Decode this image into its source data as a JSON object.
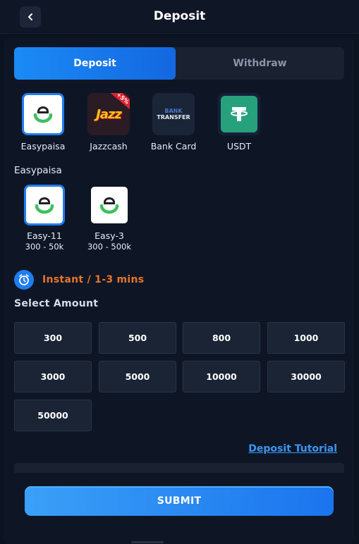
{
  "header": {
    "title": "Deposit"
  },
  "tabs": [
    {
      "label": "Deposit",
      "active": true
    },
    {
      "label": "Withdraw",
      "active": false
    }
  ],
  "methods": [
    {
      "label": "Easypaisa",
      "icon": "easypaisa-logo-icon",
      "selected": true
    },
    {
      "label": "Jazzcash",
      "icon": "jazzcash-logo-icon",
      "badge": "+5%",
      "logo_text": "Jazz"
    },
    {
      "label": "Bank Card",
      "icon": "bank-transfer-icon",
      "logo_line1": "BANK",
      "logo_line2": "TRANSFER"
    },
    {
      "label": "USDT",
      "icon": "tether-icon"
    }
  ],
  "channel_section": {
    "label": "Easypaisa"
  },
  "channels": [
    {
      "name": "Easy-11",
      "range": "300 - 50k",
      "selected": true
    },
    {
      "name": "Easy-3",
      "range": "300 - 500k",
      "selected": false
    }
  ],
  "timing": {
    "text": "Instant / 1-3 mins",
    "icon": "alarm-clock-icon"
  },
  "amount_section": {
    "label": "Select Amount"
  },
  "amounts": [
    "300",
    "500",
    "800",
    "1000",
    "3000",
    "5000",
    "10000",
    "30000",
    "50000"
  ],
  "tutorial_link": "Deposit Tutorial",
  "submit_label": "SUBMIT",
  "colors": {
    "background": "#0b1220",
    "accent": "#1f7df0",
    "timing_text": "#e8752b",
    "link": "#3c97f2"
  }
}
